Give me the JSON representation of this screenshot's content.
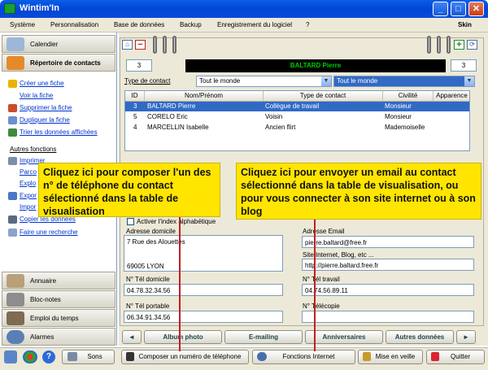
{
  "window": {
    "title": "Wintim'In",
    "minimize": "_",
    "maximize": "□",
    "close": "✕"
  },
  "menu": [
    "Système",
    "Personnalisation",
    "Base de données",
    "Backup",
    "Enregistrement du logiciel",
    "?"
  ],
  "skin_label": "Skin",
  "sidebar": {
    "calendar": "Calendier",
    "contacts": "Répertoire de contacts",
    "actions": [
      "Créer une fiche",
      "Voir la fiche",
      "Supprimer la fiche",
      "Dupliquer la fiche",
      "Trier les données affichées"
    ],
    "other_heading": "Autres fonctions",
    "other_items": [
      "Imprimer",
      "Parco",
      "Explo",
      "Expor",
      "Impor",
      "Copier les données",
      "Faire une recherche"
    ],
    "bottom_sections": [
      "Annuaire",
      "Bloc-notes",
      "Emploi du temps",
      "Alarmes"
    ]
  },
  "header": {
    "left_count": "3",
    "contact_name": "BALTARD Pierre",
    "right_count": "3",
    "add_symbol": "+",
    "remove_symbol": "−"
  },
  "filter": {
    "label": "Type de contact",
    "value_left": "Tout le monde",
    "value_right": "Tout le monde"
  },
  "table": {
    "columns": [
      "ID",
      "Nom/Prénom",
      "Type de contact",
      "Civilité",
      "Apparence"
    ],
    "rows": [
      [
        "3",
        "BALTARD Pierre",
        "Collègue de travail",
        "Monsieur",
        ""
      ],
      [
        "5",
        "CORELO Eric",
        "Voisin",
        "Monsieur",
        ""
      ],
      [
        "4",
        "MARCELLIN Isabelle",
        "Ancien flirt",
        "Mademoiselle",
        ""
      ]
    ]
  },
  "form": {
    "index_checkbox": "Activer l'index alphabétique",
    "address_label": "Adresse domicile",
    "address_line1": "7 Rue des Alouettes",
    "address_line2": "69005 LYON",
    "email_label": "Adresse Email",
    "email": "pierre.baltard@free.fr",
    "site_label": "Site Internet, Blog, etc ...",
    "site": "http://pierre.baltard.free.fr",
    "tel_home_label": "N° Tél domicile",
    "tel_home": "04.78.32.34.56",
    "tel_work_label": "N° Tél travail",
    "tel_work": "04.74.56.89.11",
    "tel_mobile_label": "N° Tél portable",
    "tel_mobile": "06.34.91.34.56",
    "fax_label": "N° Télécopie",
    "fax": ""
  },
  "tabs": [
    "◄",
    "Album photo",
    "E-mailing",
    "Anniversaires",
    "Autres données",
    "►"
  ],
  "bottom_bar": {
    "sounds": "Sons",
    "dial": "Composer un numéro de téléphone",
    "internet": "Fonctions Internet",
    "standby": "Mise en veille",
    "quit": "Quitter"
  },
  "callouts": {
    "left": "Cliquez ici pour composer l'un des n° de téléphone du contact sélectionné dans la table de visualisation",
    "right": "Cliquez ici pour envoyer un email au contact sélectionné dans la table de visualisation, ou pour vous connecter à son site internet ou à son blog"
  },
  "colors": {
    "titlebar": "#0a5ee8",
    "selected_row": "#316ac5",
    "callout": "#ffe500",
    "name_text": "#00cc00"
  }
}
